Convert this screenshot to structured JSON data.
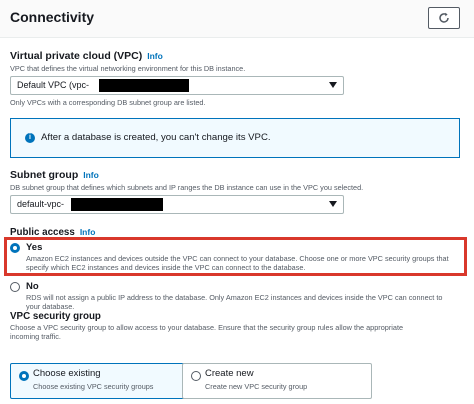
{
  "header": {
    "title": "Connectivity"
  },
  "vpc": {
    "label": "Virtual private cloud (VPC)",
    "info": "Info",
    "description": "VPC that defines the virtual networking environment for this DB instance.",
    "selected": "Default VPC (vpc-",
    "hint": "Only VPCs with a corresponding DB subnet group are listed."
  },
  "alert": {
    "icon": "i",
    "text": "After a database is created, you can't change its VPC."
  },
  "subnet": {
    "label": "Subnet group",
    "info": "Info",
    "description": "DB subnet group that defines which subnets and IP ranges the DB instance can use in the VPC you selected.",
    "selected": "default-vpc-"
  },
  "public_access": {
    "label": "Public access",
    "info": "Info",
    "yes": {
      "label": "Yes",
      "desc_line1": "Amazon EC2 instances and devices outside the VPC can connect to your database. Choose one or more VPC security groups that",
      "desc_line2": "specify which EC2 instances and devices inside the VPC can connect to the database."
    },
    "no": {
      "label": "No",
      "desc_line1": "RDS will not assign a public IP address to the database. Only Amazon EC2 instances and devices inside the VPC can connect to",
      "desc_line2": "your database."
    }
  },
  "security_group": {
    "label": "VPC security group",
    "desc_line1": "Choose a VPC security group to allow access to your database. Ensure that the security group rules allow the appropriate",
    "desc_line2": "incoming traffic.",
    "choose_existing": {
      "label": "Choose existing",
      "desc": "Choose existing VPC security groups"
    },
    "create_new": {
      "label": "Create new",
      "desc": "Create new VPC security group"
    }
  },
  "colors": {
    "accent": "#0073bb",
    "highlight": "#d9382b",
    "text": "#16191f",
    "muted": "#545b64"
  }
}
